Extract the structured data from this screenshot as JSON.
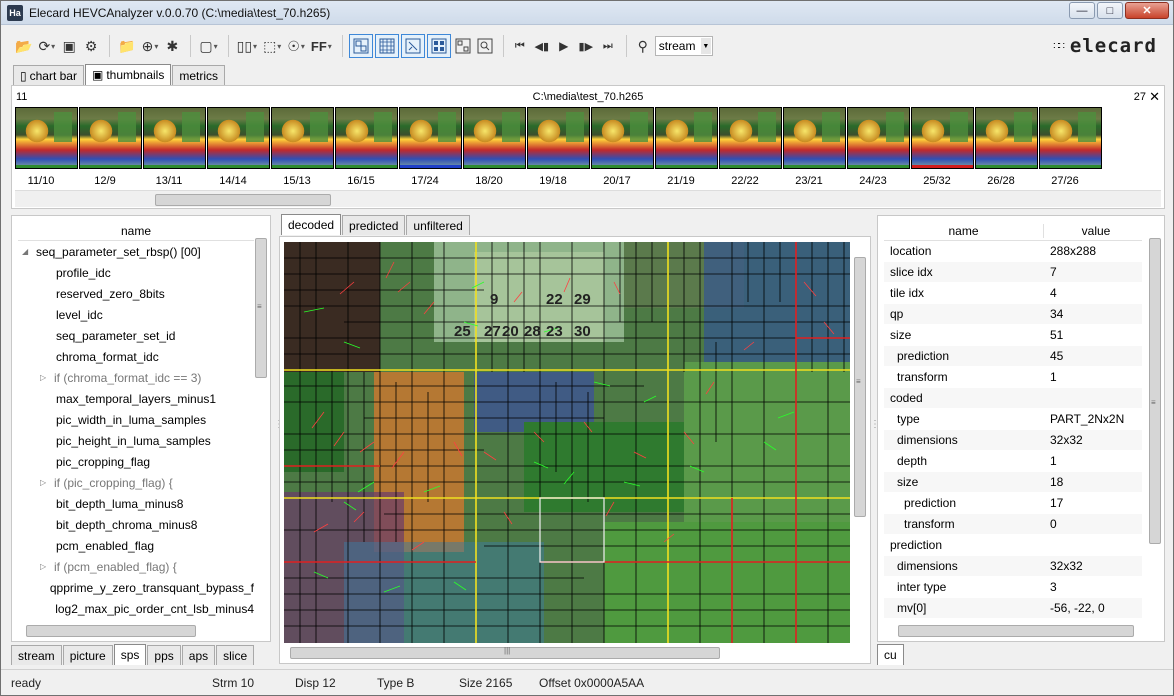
{
  "window": {
    "title": "Elecard HEVCAnalyzer v.0.0.70 (C:\\media\\test_70.h265)",
    "app_icon": "Ha",
    "controls": [
      "minimize-icon",
      "maximize-icon",
      "close-icon"
    ]
  },
  "toolbar": {
    "groups": [
      [
        "open-folder-icon",
        "reload-icon",
        "save-icon",
        "settings-gear-icon"
      ],
      [
        "open-file-icon",
        "add-icon",
        "pin-icon"
      ],
      [
        "display-options-icon"
      ],
      [
        "bar-chart-icon",
        "selection-rect-icon",
        "filter-icon",
        "fast-forward-icon"
      ]
    ],
    "ff_label": "FF",
    "view_toggles": [
      "grid-split-icon",
      "grid-dense-icon",
      "grid-zoom-icon",
      "grid-quad-icon",
      "grid-detail-icon",
      "grid-search-icon"
    ],
    "nav": [
      "first-frame-icon",
      "prev-frame-icon",
      "play-icon",
      "next-frame-icon",
      "last-frame-icon"
    ],
    "search_icon": "search-icon",
    "stream_select": "stream"
  },
  "logo": {
    "text": "elecard",
    "icon": "elecard-dots-icon"
  },
  "top_tabs": [
    {
      "label": "chart bar",
      "icon": "chart-bar-icon"
    },
    {
      "label": "thumbnails",
      "icon": "thumbnails-icon",
      "active": true
    },
    {
      "label": "metrics"
    }
  ],
  "thumbnails": {
    "left_number": "11",
    "path": "C:\\media\\test_70.h265",
    "right_number": "27",
    "close": "✕",
    "items": [
      {
        "label": "11/10",
        "bar": "#2e8b2e"
      },
      {
        "label": "12/9",
        "bar": "#2e8b2e"
      },
      {
        "label": "13/11",
        "bar": "#2e8b2e"
      },
      {
        "label": "14/14",
        "bar": "#2e8b2e"
      },
      {
        "label": "15/13",
        "bar": "#2e8b2e"
      },
      {
        "label": "16/15",
        "bar": "#2e8b2e"
      },
      {
        "label": "17/24",
        "bar": "#1e3fc8"
      },
      {
        "label": "18/20",
        "bar": "#2e8b2e"
      },
      {
        "label": "19/18",
        "bar": "#2e8b2e"
      },
      {
        "label": "20/17",
        "bar": "#2e8b2e"
      },
      {
        "label": "21/19",
        "bar": "#2e8b2e"
      },
      {
        "label": "22/22",
        "bar": "#2e8b2e"
      },
      {
        "label": "23/21",
        "bar": "#2e8b2e"
      },
      {
        "label": "24/23",
        "bar": "#2e8b2e"
      },
      {
        "label": "25/32",
        "bar": "#d01c1c"
      },
      {
        "label": "26/28",
        "bar": "#2e8b2e"
      },
      {
        "label": "27/26",
        "bar": "#2e8b2e"
      }
    ]
  },
  "tree": {
    "header": "name",
    "rows": [
      {
        "label": "seq_parameter_set_rbsp() [00]",
        "level": 0,
        "exp": "◢"
      },
      {
        "label": "profile_idc",
        "level": 1
      },
      {
        "label": "reserved_zero_8bits",
        "level": 1
      },
      {
        "label": "level_idc",
        "level": 1
      },
      {
        "label": "seq_parameter_set_id",
        "level": 1
      },
      {
        "label": "chroma_format_idc",
        "level": 1
      },
      {
        "label": "if (chroma_format_idc == 3)",
        "level": 1,
        "exp": "▷",
        "dim": true
      },
      {
        "label": "max_temporal_layers_minus1",
        "level": 1
      },
      {
        "label": "pic_width_in_luma_samples",
        "level": 1
      },
      {
        "label": "pic_height_in_luma_samples",
        "level": 1
      },
      {
        "label": "pic_cropping_flag",
        "level": 1
      },
      {
        "label": "if (pic_cropping_flag) {",
        "level": 1,
        "exp": "▷",
        "dim": true
      },
      {
        "label": "bit_depth_luma_minus8",
        "level": 1
      },
      {
        "label": "bit_depth_chroma_minus8",
        "level": 1
      },
      {
        "label": "pcm_enabled_flag",
        "level": 1
      },
      {
        "label": "if (pcm_enabled_flag) {",
        "level": 1,
        "exp": "▷",
        "dim": true
      },
      {
        "label": "qpprime_y_zero_transquant_bypass_f",
        "level": 1
      },
      {
        "label": "log2_max_pic_order_cnt_lsb_minus4",
        "level": 1
      }
    ]
  },
  "left_tabs": [
    {
      "label": "stream"
    },
    {
      "label": "picture"
    },
    {
      "label": "sps",
      "active": true
    },
    {
      "label": "pps"
    },
    {
      "label": "aps"
    },
    {
      "label": "slice"
    }
  ],
  "center_tabs": [
    {
      "label": "decoded",
      "active": true
    },
    {
      "label": "predicted"
    },
    {
      "label": "unfiltered"
    }
  ],
  "frame_text": {
    "numbers": [
      "9",
      "20",
      "22",
      "23",
      "25",
      "27",
      "28",
      "29",
      "30"
    ]
  },
  "properties": {
    "headers": {
      "name": "name",
      "value": "value"
    },
    "rows": [
      {
        "name": "location",
        "value": "288x288",
        "indent": 0
      },
      {
        "name": "slice idx",
        "value": "7",
        "indent": 0
      },
      {
        "name": "tile idx",
        "value": "4",
        "indent": 0
      },
      {
        "name": "qp",
        "value": "34",
        "indent": 0
      },
      {
        "name": "size",
        "value": "51",
        "indent": 0
      },
      {
        "name": "prediction",
        "value": "45",
        "indent": 1
      },
      {
        "name": "transform",
        "value": "1",
        "indent": 1
      },
      {
        "name": "coded",
        "value": "",
        "indent": 0
      },
      {
        "name": "type",
        "value": "PART_2Nx2N",
        "indent": 1
      },
      {
        "name": "dimensions",
        "value": "32x32",
        "indent": 1
      },
      {
        "name": "depth",
        "value": "1",
        "indent": 1
      },
      {
        "name": "size",
        "value": "18",
        "indent": 1
      },
      {
        "name": "prediction",
        "value": "17",
        "indent": 2
      },
      {
        "name": "transform",
        "value": "0",
        "indent": 2
      },
      {
        "name": "prediction",
        "value": "",
        "indent": 0
      },
      {
        "name": "dimensions",
        "value": "32x32",
        "indent": 1
      },
      {
        "name": "inter type",
        "value": "3",
        "indent": 1
      },
      {
        "name": "mv[0]",
        "value": "-56, -22, 0",
        "indent": 1
      }
    ]
  },
  "right_tabs": [
    {
      "label": "cu",
      "active": true
    }
  ],
  "status": {
    "state": "ready",
    "strm": "Strm 10",
    "disp": "Disp 12",
    "type": "Type B",
    "size": "Size 2165",
    "offset": "Offset 0x0000A5AA"
  }
}
